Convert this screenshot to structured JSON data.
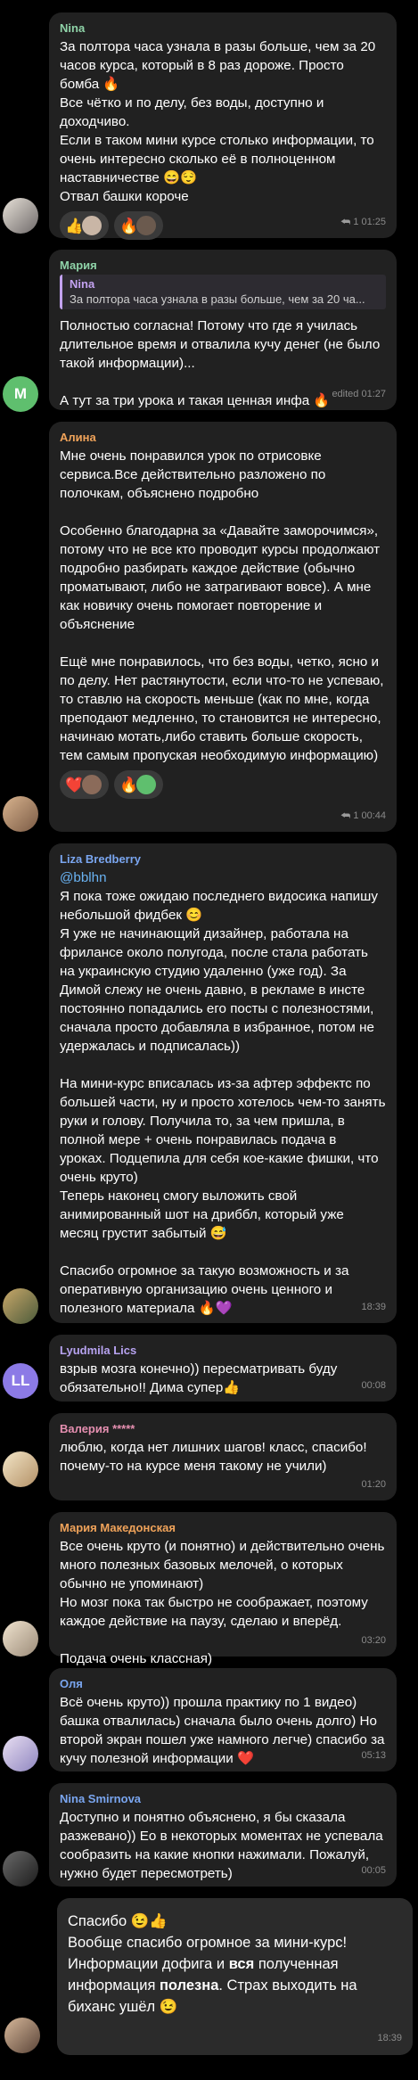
{
  "messages": [
    {
      "author": "Nina",
      "author_color": "#8fd3a8",
      "text": "За полтора часа узнала в разы больше, чем за 20 часов курса, который в 8 раз дороже. Просто бомба 🔥\nВсе чётко и по делу, без воды, доступно и доходчиво.\nЕсли в таком мини курсе столько информации, то очень интересно сколько её в полноценном наставничестве 😄😌\nОтвал башки короче",
      "reactions": [
        "👍",
        "🔥"
      ],
      "reply_count": "1",
      "time": "01:25"
    },
    {
      "author": "Мария",
      "author_color": "#8fd3a8",
      "avatar_letter": "M",
      "reply_to_name": "Nina",
      "reply_to_text": "За полтора часа узнала в разы больше, чем за 20 ча...",
      "text": "Полностью согласна! Потому что где я училась длительное время и отвалила кучу денег (не было такой информации)...\n\nА тут за три урока и такая ценная инфа 🔥",
      "time": "edited 01:27"
    },
    {
      "author": "Алина",
      "author_color": "#f0a35a",
      "text": "Мне очень понравился урок по отрисовке сервиса.Все действительно разложено по полочкам, объяснено подробно\n\nОсобенно благодарна за «Давайте заморочимся», потому что не все кто проводит курсы продолжают подробно разбирать каждое действие (обычно проматывают, либо не затрагивают вовсе). А мне как новичку очень помогает повторение и объяснение\n\nЕщё мне понравилось, что без воды, четко, ясно и по делу. Нет растянутости, если что-то не успеваю, то ставлю на скорость меньше (как по мне, когда преподают медленно, то становится не интересно, начинаю мотать,либо ставить больше скорость, тем самым пропуская необходимую информацию)",
      "reactions": [
        "❤️",
        "🔥"
      ],
      "reply_count": "1",
      "time": "00:44"
    },
    {
      "author": "Liza Bredberry",
      "author_color": "#7aa6f0",
      "link": "@bblhn",
      "text": "Я пока тоже ожидаю последнего видосика напишу небольшой фидбек 😊\nЯ уже не начинающий дизайнер, работала на фрилансе около полугода, после стала работать на украинскую студию удаленно (уже год). За Димой слежу не очень давно, в рекламе в инсте постоянно попадались его посты с полезностями, сначала просто добавляла в избранное, потом не удержалась и подписалась))\n\nНа мини-курс вписалась из-за афтер эффектс по большей части, ну и просто хотелось чем-то занять руки и голову. Получила то, за чем пришла, в полной мере + очень понравилась подача в уроках. Подцепила для себя кое-какие фишки, что очень круто)\nТеперь наконец смогу выложить свой анимированный шот на дриббл, который уже месяц грустит забытый 😅\n\nСпасибо огромное за такую возможность и за оперативную организацию очень ценного и полезного материала 🔥💜",
      "time": "18:39"
    },
    {
      "author": "Lyudmila Lics",
      "author_color": "#b7a3f0",
      "avatar_letter": "LL",
      "text": "взрыв мозга конечно)) пересматривать буду обязательно!! Дима супер👍",
      "time": "00:08"
    },
    {
      "author": "Валерия *****",
      "author_color": "#e58fb0",
      "text": "люблю, когда нет лишних шагов! класс, спасибо! почему-то на курсе меня такому не учили)",
      "time": "01:20"
    },
    {
      "author": "Мария Македонская",
      "author_color": "#f0a35a",
      "text": "Все очень круто (и понятно) и действительно очень много полезных базовых мелочей, о которых обычно не упоминают)\nНо мозг пока так быстро не соображает, поэтому каждое действие на паузу, сделаю и вперёд.\n\nПодача очень классная)",
      "time": "03:20"
    },
    {
      "author": "Оля",
      "author_color": "#7aa6f0",
      "text": "Всё очень круто)) прошла практику по 1 видео) башка отвалилась) сначала было очень долго) Но второй экран пошел уже намного легче) спасибо за кучу полезной информации ❤️",
      "time": "05:13"
    },
    {
      "author": "Nina Smirnova",
      "author_color": "#7aa6f0",
      "text": "Доступно и понятно объяснено, я бы сказала разжевано)) Ео в некоторых моментах не успевала сообразить на какие кнопки нажимали. Пожалуй, нужно будет пересмотреть)",
      "time": "00:05"
    },
    {
      "text_part1": "Спасибо 😉👍\nВообще спасибо огромное за мини-курс! Информации дофига и ",
      "bold1": "вся",
      "text_part2": " полученная информация ",
      "bold2": "полезна",
      "text_part3": ". Страх выходить на биханс ушёл 😉",
      "time": "18:39"
    }
  ]
}
